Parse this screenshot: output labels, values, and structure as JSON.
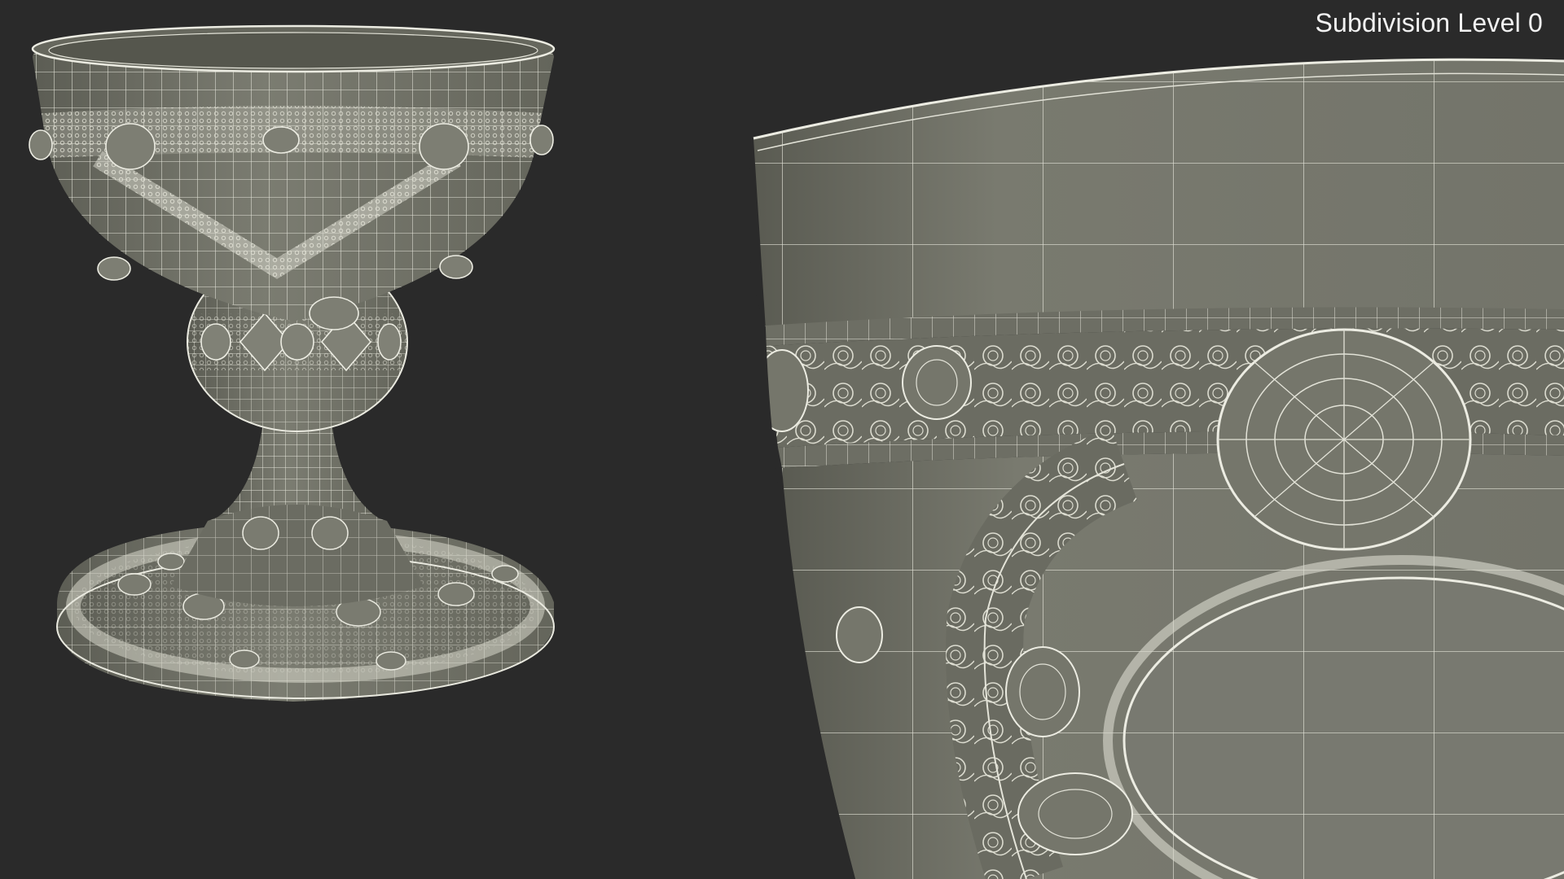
{
  "viewport": {
    "label": "Subdivision Level 0"
  },
  "colors": {
    "background": "#2a2a2a",
    "surface": "#74756a",
    "surface_dark": "#5f6057",
    "wire": "#e9e9df",
    "ornament": "#d8d8cc"
  },
  "views": [
    "full-chalice-wireframe",
    "closeup-bowl-rim-wireframe"
  ]
}
